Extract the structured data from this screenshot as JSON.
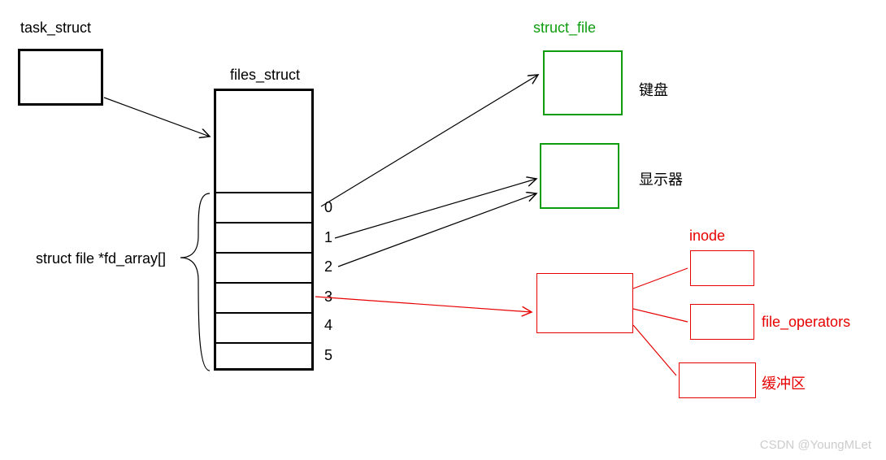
{
  "labels": {
    "task_struct": "task_struct",
    "files_struct": "files_struct",
    "fd_array": "struct file *fd_array[]",
    "struct_file": "struct_file",
    "keyboard": "键盘",
    "display": "显示器",
    "inode": "inode",
    "file_operators": "file_operators",
    "buffer": "缓冲区",
    "watermark": "CSDN @YoungMLet"
  },
  "fd_indices": [
    "0",
    "1",
    "2",
    "3",
    "4",
    "5"
  ],
  "colors": {
    "green": "#0d9c0d",
    "red": "#e60000",
    "black": "#000000"
  }
}
